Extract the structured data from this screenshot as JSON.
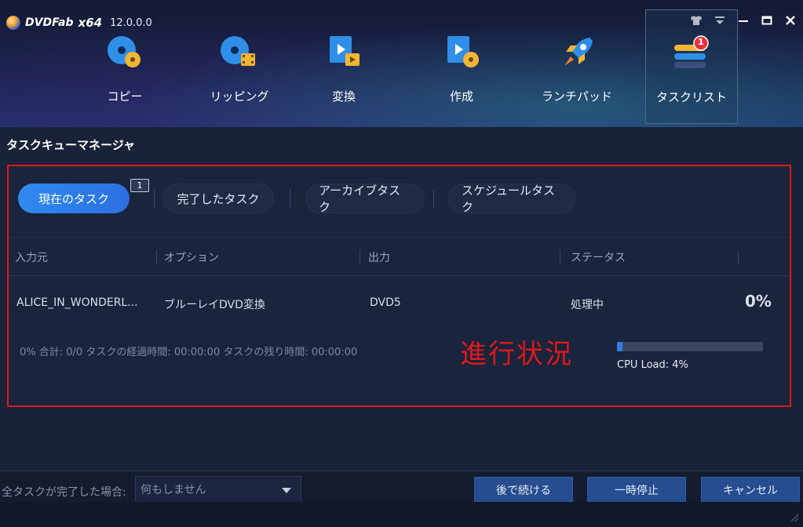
{
  "app": {
    "brand": "DVDFab",
    "arch": "x64",
    "version": "12.0.0.0"
  },
  "nav": {
    "items": [
      {
        "label": "コピー",
        "icon": "disc-copy-icon"
      },
      {
        "label": "リッピング",
        "icon": "disc-rip-icon"
      },
      {
        "label": "変換",
        "icon": "video-convert-icon"
      },
      {
        "label": "作成",
        "icon": "video-create-icon"
      },
      {
        "label": "ランチパッド",
        "icon": "rocket-icon"
      },
      {
        "label": "タスクリスト",
        "icon": "task-list-icon",
        "badge": "1",
        "active": true
      }
    ]
  },
  "page": {
    "title": "タスクキューマネージャ"
  },
  "tabs": {
    "current": "現在のタスク",
    "current_badge": "1",
    "completed": "完了したタスク",
    "archive": "アーカイブタスク",
    "schedule": "スケジュールタスク"
  },
  "table": {
    "headers": {
      "source": "入力元",
      "option": "オプション",
      "output": "出力",
      "status": "ステータス"
    },
    "row": {
      "source": "ALICE_IN_WONDERL...",
      "option": "ブルーレイDVD変換",
      "output": "DVD5",
      "status": "処理中",
      "percent": "0%",
      "progress_text": "0%    合計: 0/0  タスクの経過時間: 00:00:00  タスクの残り時間: 00:00:00",
      "cpu": "CPU Load: 4%",
      "progress": 0.04
    }
  },
  "annotation": "進行状況",
  "footer": {
    "label": "全タスクが完了した場合:",
    "select_value": "何もしません",
    "continue_later": "後で続ける",
    "pause": "一時停止",
    "cancel": "キャンセル"
  },
  "colors": {
    "accent": "#2f7fe8",
    "highlight_red": "#e01818",
    "button": "#264d8f"
  }
}
